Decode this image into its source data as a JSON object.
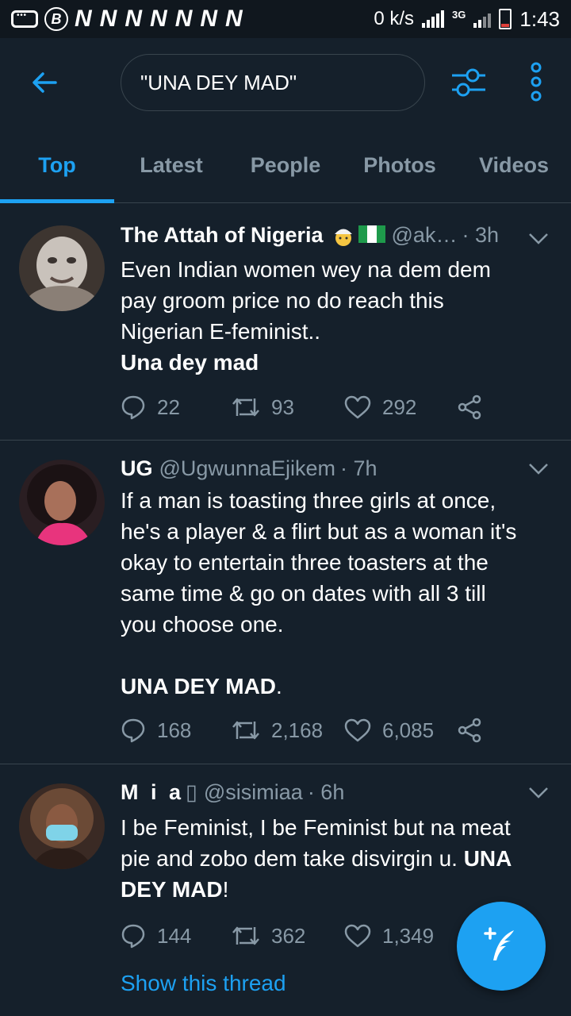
{
  "status_bar": {
    "left_badge": "B",
    "notif_letters": [
      "N",
      "N",
      "N",
      "N",
      "N",
      "N",
      "N"
    ],
    "speed": "0 k/s",
    "network": "3G",
    "time": "1:43"
  },
  "search": {
    "query": "\"UNA DEY MAD\"",
    "icons": {
      "back": "back-arrow-icon",
      "filter": "filter-sliders-icon",
      "more": "more-vertical-icon"
    }
  },
  "tabs": [
    {
      "label": "Top",
      "active": true
    },
    {
      "label": "Latest",
      "active": false
    },
    {
      "label": "People",
      "active": false
    },
    {
      "label": "Photos",
      "active": false
    },
    {
      "label": "Videos",
      "active": false
    }
  ],
  "tweets": [
    {
      "name": "The Attah of Nigeria",
      "handle": "@ak…",
      "time": "· 3h",
      "text_plain": [
        "Even Indian women wey na dem dem",
        "pay groom price no do reach this",
        "Nigerian E-feminist.."
      ],
      "text_bold": "Una dey mad",
      "replies": "22",
      "retweets": "93",
      "likes": "292"
    },
    {
      "name": "UG",
      "handle": "@UgwunnaEjikem",
      "time": "· 7h",
      "text_plain": [
        "If a man is toasting three girls at once,",
        "he's a player & a flirt but as a woman it's",
        "okay to entertain three toasters at the",
        "same time & go on dates with all 3 till",
        "you choose one."
      ],
      "text_bold": "UNA DEY MAD",
      "text_tail": ".",
      "replies": "168",
      "retweets": "2,168",
      "likes": "6,085"
    },
    {
      "name": "M i a",
      "name_glyph": "▯",
      "handle": "@sisimiaa",
      "time": "· 6h",
      "line1": "I be Feminist, I be Feminist but na meat",
      "line2_plain": "pie and zobo dem take disvirgin u. ",
      "line2_bold": "UNA",
      "line3_bold": "DEY MAD",
      "line3_tail": "!",
      "replies": "144",
      "retweets": "362",
      "likes": "1,349",
      "thread_link": "Show this thread"
    }
  ],
  "colors": {
    "background": "#15202b",
    "accent": "#1da1f2",
    "muted": "#8899a6",
    "divider": "#38444d"
  }
}
